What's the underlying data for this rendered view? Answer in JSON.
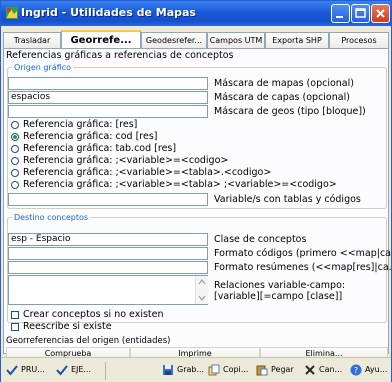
{
  "window": {
    "title": "Ingrid - Utilidades de Mapas"
  },
  "tabs": [
    {
      "label": "Trasladar"
    },
    {
      "label": "Georrefe..."
    },
    {
      "label": "Geodesrefer..."
    },
    {
      "label": "Campos UTM"
    },
    {
      "label": "Exporta SHP"
    },
    {
      "label": "Procesos"
    }
  ],
  "panel": {
    "heading": "Referencias gráficas a referencias de conceptos",
    "origin": {
      "group_label": "Origen gráfico",
      "fields": [
        {
          "value": "",
          "label": "Máscara de mapas (opcional)"
        },
        {
          "value": "espacios",
          "label": "Máscara de capas (opcional)"
        },
        {
          "value": "",
          "label": "Máscara de geos (tipo [bloque])"
        }
      ],
      "radios": [
        {
          "label": "Referencia gráfica: [res]",
          "selected": false
        },
        {
          "label": "Referencia gráfica: cod [res]",
          "selected": true
        },
        {
          "label": "Referencia gráfica: tab.cod [res]",
          "selected": false
        },
        {
          "label": "Referencia gráfica: ;<variable>=<codigo>",
          "selected": false
        },
        {
          "label": "Referencia gráfica: ;<variable>=<tabla>.<codigo>",
          "selected": false
        },
        {
          "label": "Referencia gráfica: ;<variable>=<tabla> ;<variable>=<codigo>",
          "selected": false
        }
      ],
      "variables_field": {
        "value": "",
        "label": "Variable/s con tablas y códigos"
      }
    },
    "destination": {
      "group_label": "Destino conceptos",
      "fields": [
        {
          "value": "esp - Espacio",
          "label": "Clase de conceptos"
        },
        {
          "value": "",
          "label": "Formato códigos (primero <<map|ca..."
        },
        {
          "value": "",
          "label": "Formato resúmenes (<<map[res]|ca..."
        }
      ],
      "relations_label_1": "Relaciones variable-campo:",
      "relations_label_2": "[variable][=campo [clase]]",
      "checkboxes": [
        {
          "label": "Crear conceptos si no existen",
          "checked": false
        },
        {
          "label": "Reescribe si existe",
          "checked": false
        }
      ]
    },
    "georef_label": "Georreferencias del origen (entidades)",
    "buttons": {
      "check": "Comprueba",
      "print": "Imprime",
      "delete": "Elimina..."
    }
  },
  "footer": {
    "buttons": [
      {
        "label": "PRU...",
        "icon": "check-icon"
      },
      {
        "label": "EJE...",
        "icon": "check-icon"
      },
      {
        "label": "Grab...",
        "icon": "save-icon"
      },
      {
        "label": "Copi...",
        "icon": "copy-icon"
      },
      {
        "label": "Pegar",
        "icon": "paste-icon"
      },
      {
        "label": "Can...",
        "icon": "cancel-icon"
      },
      {
        "label": "Ayu...",
        "icon": "help-icon"
      }
    ]
  }
}
